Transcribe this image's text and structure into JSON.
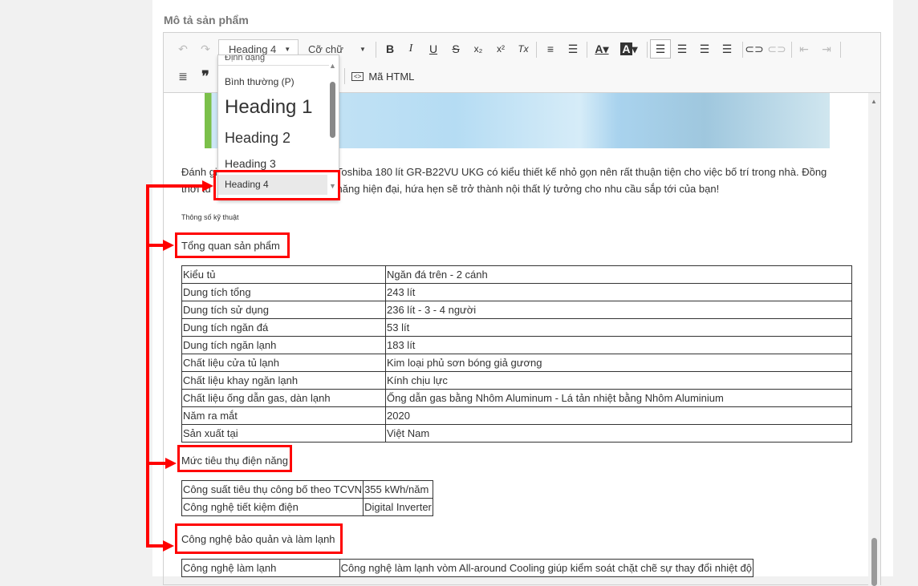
{
  "label": "Mô tả sản phẩm",
  "toolbar": {
    "undo": "↶",
    "redo": "↷",
    "format_value": "Heading 4",
    "font_size_placeholder": "Cỡ chữ",
    "bold": "B",
    "italic": "I",
    "underline": "U",
    "strike": "S",
    "subscript": "x₂",
    "superscript": "x²",
    "remove_format": "Tx",
    "html_label": "Mã HTML",
    "quote": "❞"
  },
  "dropdown": {
    "header": "Định dạng",
    "items": [
      "Bình thường (P)",
      "Heading 1",
      "Heading 2",
      "Heading 3",
      "Heading 4"
    ],
    "selected": "Heading 4"
  },
  "content": {
    "paragraph_1a": "Đánh giá",
    "paragraph_1b": "rter Toshiba 180 lít GR-B22VU UKG có kiểu thiết kế nhỏ gọn nên rất thuận tiện cho việc bố trí trong nhà. Đồng",
    "paragraph_2a": "thời tủ",
    "paragraph_2b": "n năng hiện đại, hứa hẹn sẽ trở thành nội thất lý tưởng cho nhu cầu sắp tới của bạn!",
    "spec_title": "Thông số kỹ thuật",
    "heading_overview": "Tổng quan sản phẩm",
    "overview_rows": [
      [
        "Kiểu tủ",
        "Ngăn đá trên - 2 cánh"
      ],
      [
        "Dung tích tổng",
        "243 lít"
      ],
      [
        "Dung tích sử dụng",
        "236 lít - 3 - 4 người"
      ],
      [
        "Dung tích ngăn đá",
        "53 lít"
      ],
      [
        "Dung tích ngăn lạnh",
        "183 lít"
      ],
      [
        "Chất liệu cửa tủ lạnh",
        "Kim loại phủ sơn bóng giả gương"
      ],
      [
        "Chất liệu khay ngăn lạnh",
        "Kính chịu lực"
      ],
      [
        "Chất liệu ống dẫn gas, dàn lạnh",
        "Ống dẫn gas bằng Nhôm Aluminum - Lá tản nhiệt bằng Nhôm Aluminium"
      ],
      [
        "Năm ra mắt",
        "2020"
      ],
      [
        "Sản xuất tại",
        "Việt Nam"
      ]
    ],
    "heading_power": "Mức tiêu thụ điện năng",
    "power_rows": [
      [
        "Công suất tiêu thụ công bố theo TCVN",
        "355 kWh/năm"
      ],
      [
        "Công nghệ tiết kiệm điện",
        "Digital Inverter"
      ]
    ],
    "heading_cooling": "Công nghệ bảo quản và làm lạnh",
    "cooling_rows": [
      [
        "Công nghệ làm lạnh",
        "Công nghệ làm lạnh vòm All-around Cooling giúp kiểm soát chặt chẽ sự thay đổi nhiệt độ"
      ]
    ]
  },
  "colors": {
    "annotation": "#ff0000"
  }
}
